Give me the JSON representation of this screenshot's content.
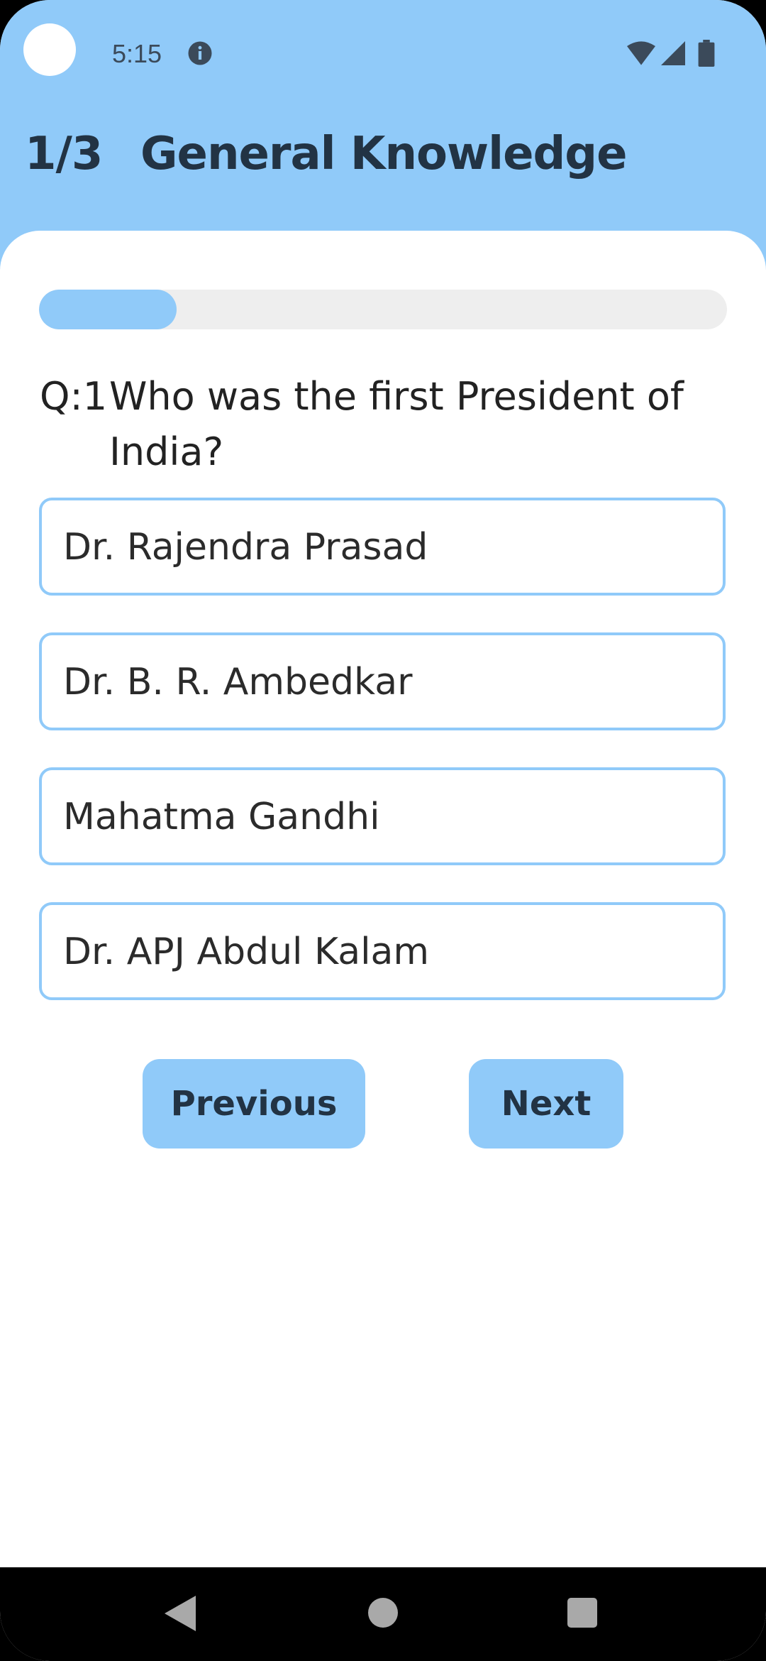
{
  "status_bar": {
    "time": "5:15",
    "icons": [
      "info-icon",
      "wifi-icon",
      "signal-icon",
      "battery-icon"
    ]
  },
  "header": {
    "counter": "1/3",
    "title": "General Knowledge"
  },
  "progress": {
    "value": 0.2
  },
  "question": {
    "prefix": "Q:1",
    "text": "Who was the first President of India?"
  },
  "options": [
    {
      "label": "Dr. Rajendra Prasad"
    },
    {
      "label": "Dr. B. R. Ambedkar"
    },
    {
      "label": "Mahatma Gandhi"
    },
    {
      "label": "Dr. APJ Abdul Kalam"
    }
  ],
  "buttons": {
    "previous": "Previous",
    "next": "Next"
  },
  "nav_bar": {
    "icons": [
      "back-icon",
      "home-icon",
      "recents-icon"
    ]
  },
  "colors": {
    "accent": "#90CAF9",
    "text_dark": "#223344",
    "track": "#EEEEEE"
  }
}
